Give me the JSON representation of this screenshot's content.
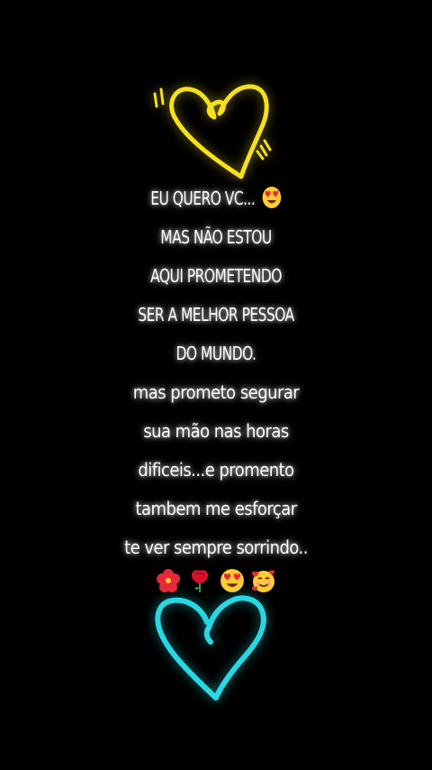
{
  "message": {
    "lines": [
      "EU QUERO VC...",
      "MAS NÃO ESTOU",
      "AQUI PROMETENDO",
      "SER A MELHOR PESSOA",
      "DO MUNDO.",
      "mas prometo segurar",
      "sua mão nas horas",
      "dificeis...e promento",
      "tambem me esforçar",
      "te ver sempre sorrindo.."
    ]
  },
  "decorations": {
    "top_heart": {
      "icon": "yellow-heart-doodle-icon",
      "color": "#f5e11b"
    },
    "bottom_heart": {
      "icon": "cyan-heart-doodle-icon",
      "color": "#27d8e4"
    },
    "inline_emoji": "heart-eyes-emoji-icon",
    "emoji_row": [
      "hibiscus-icon",
      "rose-icon",
      "heart-eyes-emoji-icon",
      "smiling-face-with-hearts-icon"
    ]
  },
  "colors": {
    "background": "#000000",
    "text": "#ffffff"
  }
}
